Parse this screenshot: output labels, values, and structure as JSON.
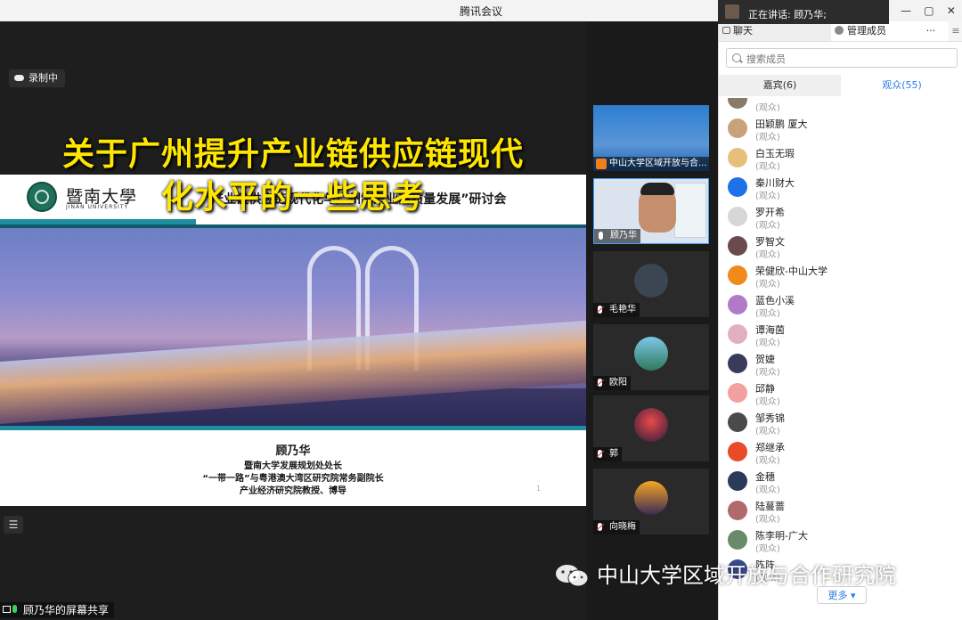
{
  "app": {
    "title": "腾讯会议"
  },
  "speaking": {
    "label": "正在讲话: 顾乃华;"
  },
  "window_controls": {
    "minimize": "—",
    "maximize": "▢",
    "close": "✕"
  },
  "recording": {
    "label": "录制中"
  },
  "slide": {
    "logo_cn": "暨南大學",
    "logo_en": "JINAN UNIVERSITY",
    "subject": "“产业链供应链现代化与广州制造业高质量发展”研讨会",
    "headline_line1": "关于广州提升产业链供应链现代",
    "headline_line2": "化水平的一些思考",
    "presenter_name": "顾乃华",
    "presenter_title1": "暨南大学发展规划处处长",
    "presenter_title2": "“一带一路”与粤港澳大湾区研究院常务副院长",
    "presenter_title3": "产业经济研究院教授、博导",
    "page_number": "1"
  },
  "share": {
    "label": "顾乃华的屏幕共享"
  },
  "thumbnails": [
    {
      "label": "中山大学区域开放与合..."
    },
    {
      "label": "顾乃华"
    },
    {
      "label": "毛艳华"
    },
    {
      "label": "欧阳"
    },
    {
      "label": "郭"
    },
    {
      "label": "向晓梅"
    }
  ],
  "panel": {
    "tab_chat": "聊天",
    "tab_members": "管理成员",
    "more_icon": "···",
    "search_placeholder": "搜索成员",
    "tab_guests": "嘉宾(6)",
    "tab_audience": "观众(55)",
    "more_button": "更多 ▾",
    "members": [
      {
        "name": "",
        "role": "(观众)",
        "color": "#8a7a6a"
      },
      {
        "name": "田颖鹏 厦大",
        "role": "(观众)",
        "color": "#c9a27a"
      },
      {
        "name": "白玉无瑕",
        "role": "(观众)",
        "color": "#e6c07a"
      },
      {
        "name": "秦川财大",
        "role": "(观众)",
        "color": "#1e72e8"
      },
      {
        "name": "罗开希",
        "role": "(观众)",
        "color": "#d7d7d7"
      },
      {
        "name": "罗智文",
        "role": "(观众)",
        "color": "#6a4a4a"
      },
      {
        "name": "荣健欣-中山大学",
        "role": "(观众)",
        "color": "#f08a1a"
      },
      {
        "name": "蓝色小溪",
        "role": "(观众)",
        "color": "#b07ac8"
      },
      {
        "name": "谭海茵",
        "role": "(观众)",
        "color": "#e0b0c0"
      },
      {
        "name": "贺婕",
        "role": "(观众)",
        "color": "#3a3a5a"
      },
      {
        "name": "邱静",
        "role": "(观众)",
        "color": "#f2a0a0"
      },
      {
        "name": "邹秀锦",
        "role": "(观众)",
        "color": "#4a4a4a"
      },
      {
        "name": "郑继承",
        "role": "(观众)",
        "color": "#e84a2a"
      },
      {
        "name": "金穗",
        "role": "(观众)",
        "color": "#2a3a5a"
      },
      {
        "name": "陆蔓蔷",
        "role": "(观众)",
        "color": "#b06a6a"
      },
      {
        "name": "陈李明-广大",
        "role": "(观众)",
        "color": "#6a8a6a"
      },
      {
        "name": "陈阵",
        "role": "(观众)",
        "color": "#3a4a8a"
      }
    ]
  },
  "watermark": {
    "text": "中山大学区域开放与合作研究院"
  }
}
